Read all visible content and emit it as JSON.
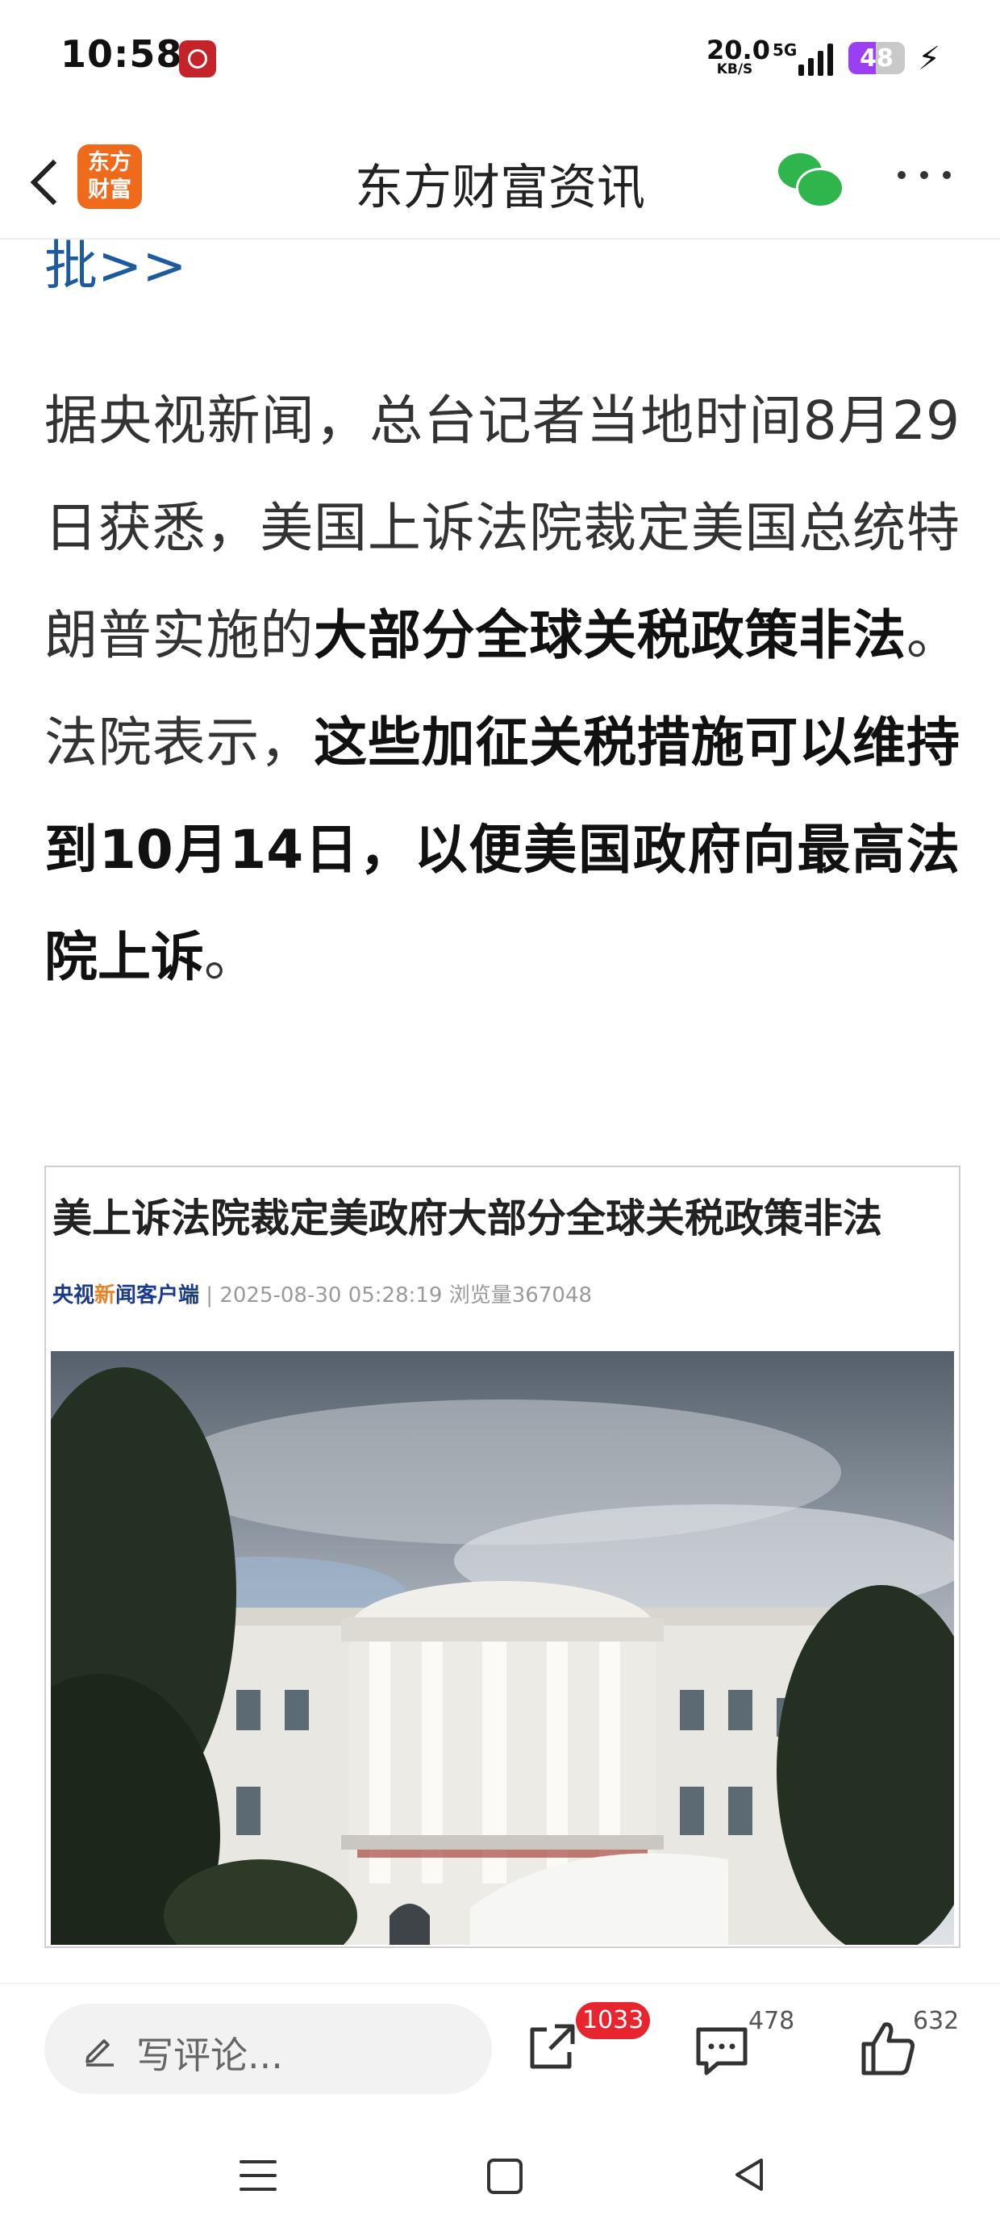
{
  "status_bar": {
    "time": "10:58",
    "net_speed_value": "20.0",
    "net_speed_unit": "KB/S",
    "network_type": "5G",
    "battery": "48",
    "battery_level": 0.48
  },
  "nav": {
    "logo_text_1": "东方",
    "logo_text_2": "财富",
    "title": "东方财富资讯"
  },
  "article": {
    "link_tail": "批>>",
    "p1": "据央视新闻，总台记者当地时间8月29日获悉，美国上诉法院裁定美国总统特朗普实施的",
    "p2": "大部分全球关税政策非法",
    "p3": "。法院表示，",
    "p4": "这些加征关税措施可以维持到10月14日，以便美国政府向最高法院上诉",
    "p5": "。"
  },
  "embedded_image": {
    "headline": "美上诉法院裁定美政府大部分全球关税政策非法",
    "source_part1": "央视",
    "source_part2": "新",
    "source_part3": "闻客户端",
    "meta": " | 2025-08-30 05:28:19  浏览量367048"
  },
  "bottom_bar": {
    "comment_placeholder": "写评论...",
    "share_badge": "1033",
    "comment_count": "478",
    "like_count": "632"
  },
  "colors": {
    "brand_orange": "#f06a1c",
    "link_blue": "#1e5a9e",
    "badge_red": "#e8242f",
    "wechat_green": "#2eb54b",
    "battery_purple": "#9b3ff0"
  },
  "icons": [
    "notification-icon",
    "back-arrow-icon",
    "wechat-icon",
    "more-icon",
    "pencil-icon",
    "share-icon",
    "comments-icon",
    "like-icon",
    "menu-icon",
    "home-icon",
    "back-icon"
  ]
}
